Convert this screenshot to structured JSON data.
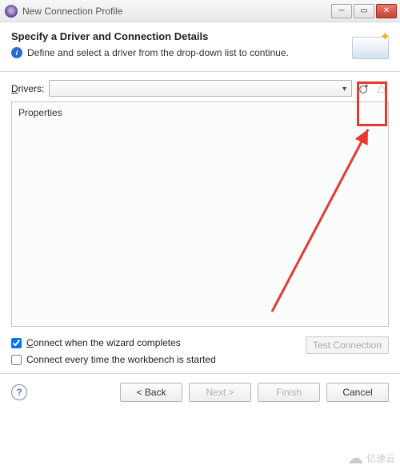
{
  "titlebar": {
    "title": "New Connection Profile"
  },
  "header": {
    "heading": "Specify a Driver and Connection Details",
    "description": "Define and select a driver from the drop-down list to continue."
  },
  "drivers": {
    "label_pre": "D",
    "label_rest": "rivers:",
    "selected": ""
  },
  "properties": {
    "label": "Properties"
  },
  "checks": {
    "connect_on_complete_pre": "C",
    "connect_on_complete_rest": "onnect when the wizard completes",
    "connect_on_complete_checked": true,
    "connect_every_start": "Connect every time the workbench is started",
    "connect_every_start_checked": false
  },
  "buttons": {
    "test": "Test Connection",
    "back": "< Back",
    "next": "Next >",
    "finish": "Finish",
    "cancel": "Cancel"
  },
  "watermark": "亿速云"
}
